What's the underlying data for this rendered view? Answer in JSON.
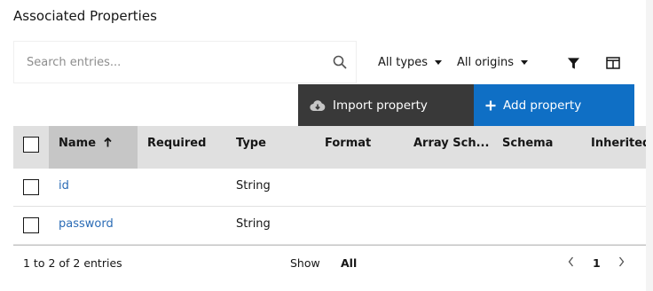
{
  "title": "Associated Properties",
  "search": {
    "placeholder": "Search entries...",
    "value": ""
  },
  "filters": {
    "types": "All types",
    "origins": "All origins"
  },
  "icons": {
    "search": "search-icon",
    "caret": "caret-down-icon",
    "filter": "filter-icon",
    "columns": "columns-icon",
    "import": "cloud-download-icon",
    "add": "plus-icon",
    "sort": "arrow-up-icon",
    "prev": "chevron-left-icon",
    "next": "chevron-right-icon"
  },
  "actions": {
    "import_label": "Import property",
    "add_label": "Add property"
  },
  "colors": {
    "import_bg": "#393939",
    "add_bg": "#0f6fc5",
    "link": "#2a6bb5",
    "header_bg": "#e0e0e0",
    "sorted_header_bg": "#c6c6c6"
  },
  "table": {
    "columns": [
      "Name",
      "Required",
      "Type",
      "Format",
      "Array Sch...",
      "Schema",
      "Inherited"
    ],
    "sorted_column": "Name",
    "rows": [
      {
        "name": "id",
        "required": "",
        "type": "String"
      },
      {
        "name": "password",
        "required": "",
        "type": "String"
      }
    ]
  },
  "pagination": {
    "summary": "1 to 2 of 2 entries",
    "show_label": "Show",
    "show_value": "All",
    "page": "1"
  }
}
